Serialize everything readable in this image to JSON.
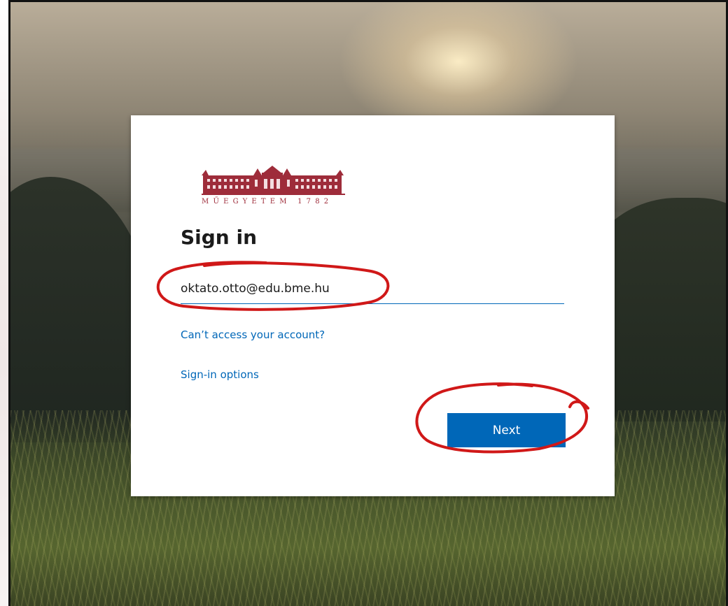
{
  "logo": {
    "text": "MŰEGYETEM 1782",
    "color": "#9e2c3a"
  },
  "signin": {
    "title": "Sign in",
    "email_value": "oktato.otto@edu.bme.hu",
    "cant_access_label": "Can’t access your account?",
    "signin_options_label": "Sign-in options",
    "next_label": "Next"
  },
  "colors": {
    "accent": "#0067b8",
    "annotation": "#d01818"
  }
}
